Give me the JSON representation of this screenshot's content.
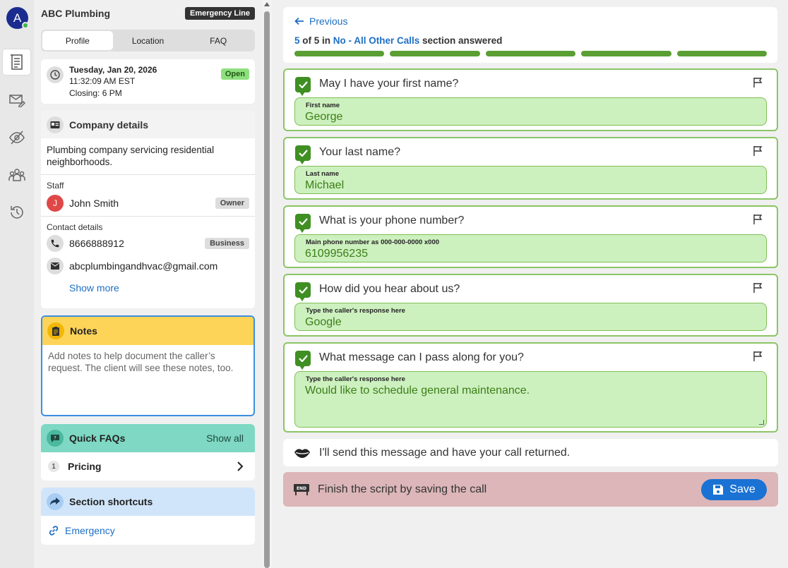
{
  "rail": {
    "avatar_letter": "A",
    "icons": [
      "script-icon",
      "mail-edit-icon",
      "eye-off-icon",
      "team-icon",
      "history-icon"
    ]
  },
  "company": {
    "name": "ABC Plumbing",
    "line_badge": "Emergency Line"
  },
  "tabs": [
    "Profile",
    "Location",
    "FAQ"
  ],
  "datetime": {
    "date": "Tuesday, Jan 20, 2026",
    "time": "11:32:09 AM EST",
    "closing": "Closing: 6 PM",
    "status": "Open"
  },
  "company_details": {
    "title": "Company details",
    "description": "Plumbing company servicing residential neighborhoods.",
    "staff_label": "Staff",
    "staff": [
      {
        "initial": "J",
        "name": "John Smith",
        "role": "Owner"
      }
    ],
    "contact_label": "Contact details",
    "phone": "8666888912",
    "phone_type": "Business",
    "email": "abcplumbingandhvac@gmail.com",
    "show_more": "Show more"
  },
  "notes": {
    "title": "Notes",
    "placeholder": "Add notes to help document the caller’s request. The client will see these notes, too."
  },
  "faqs": {
    "title": "Quick FAQs",
    "show_all": "Show all",
    "items": [
      {
        "num": "1",
        "label": "Pricing"
      }
    ]
  },
  "shortcuts": {
    "title": "Section shortcuts",
    "items": [
      {
        "label": "Emergency"
      }
    ]
  },
  "progress": {
    "previous": "Previous",
    "current": "5",
    "of_text": " of 5 in ",
    "section": "No - All Other Calls",
    "suffix": " section answered",
    "total": 5,
    "done": 5,
    "color": "#5a9e34"
  },
  "questions": [
    {
      "text": "May I have your first name?",
      "label": "First name",
      "value": "George"
    },
    {
      "text": "Your last name?",
      "label": "Last name",
      "value": "Michael"
    },
    {
      "text": "What is your phone number?",
      "label": "Main phone number as 000-000-0000 x000",
      "value": "6109956235"
    },
    {
      "text": "How did you hear about us?",
      "label": "Type the caller's response here",
      "value": "Google"
    },
    {
      "text": "What message can I pass along for you?",
      "label": "Type the caller's response here",
      "value": "Would like to schedule general maintenance."
    }
  ],
  "say_line": "I'll send this message and have your call returned.",
  "finish": {
    "text": "Finish the script by saving the call",
    "end_tag": "END",
    "save_label": "Save"
  }
}
